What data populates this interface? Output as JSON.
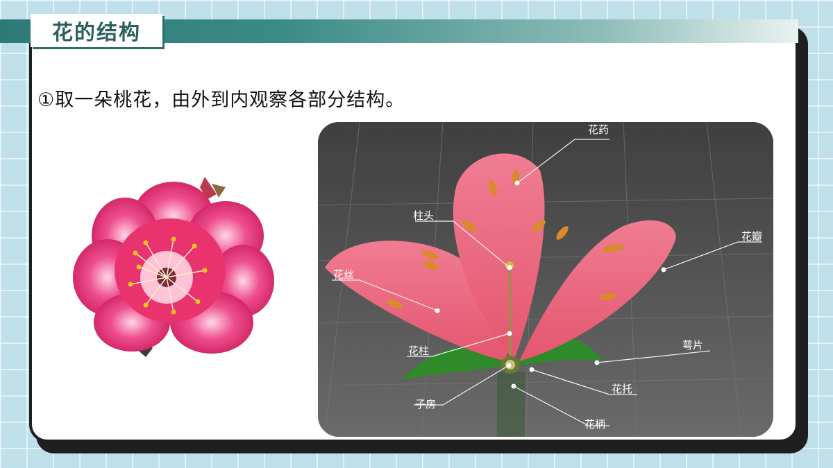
{
  "page": {
    "title": "花的结构",
    "instruction": "①取一朵桃花，由外到内观察各部分结构。"
  },
  "diagram": {
    "labels": {
      "anther": "花药",
      "stigma": "柱头",
      "petal": "花瓣",
      "filament": "花丝",
      "style": "花柱",
      "sepal": "萼片",
      "receptacle": "花托",
      "ovary": "子房",
      "pedicel": "花柄"
    }
  },
  "colors": {
    "title_band": "#2d7a78",
    "title_text": "#2b5f5d",
    "petal_pink": "#e8607a",
    "peach_magenta": "#e0266a",
    "sepal_green": "#2f8a2a",
    "diagram_bg": "#555555"
  }
}
